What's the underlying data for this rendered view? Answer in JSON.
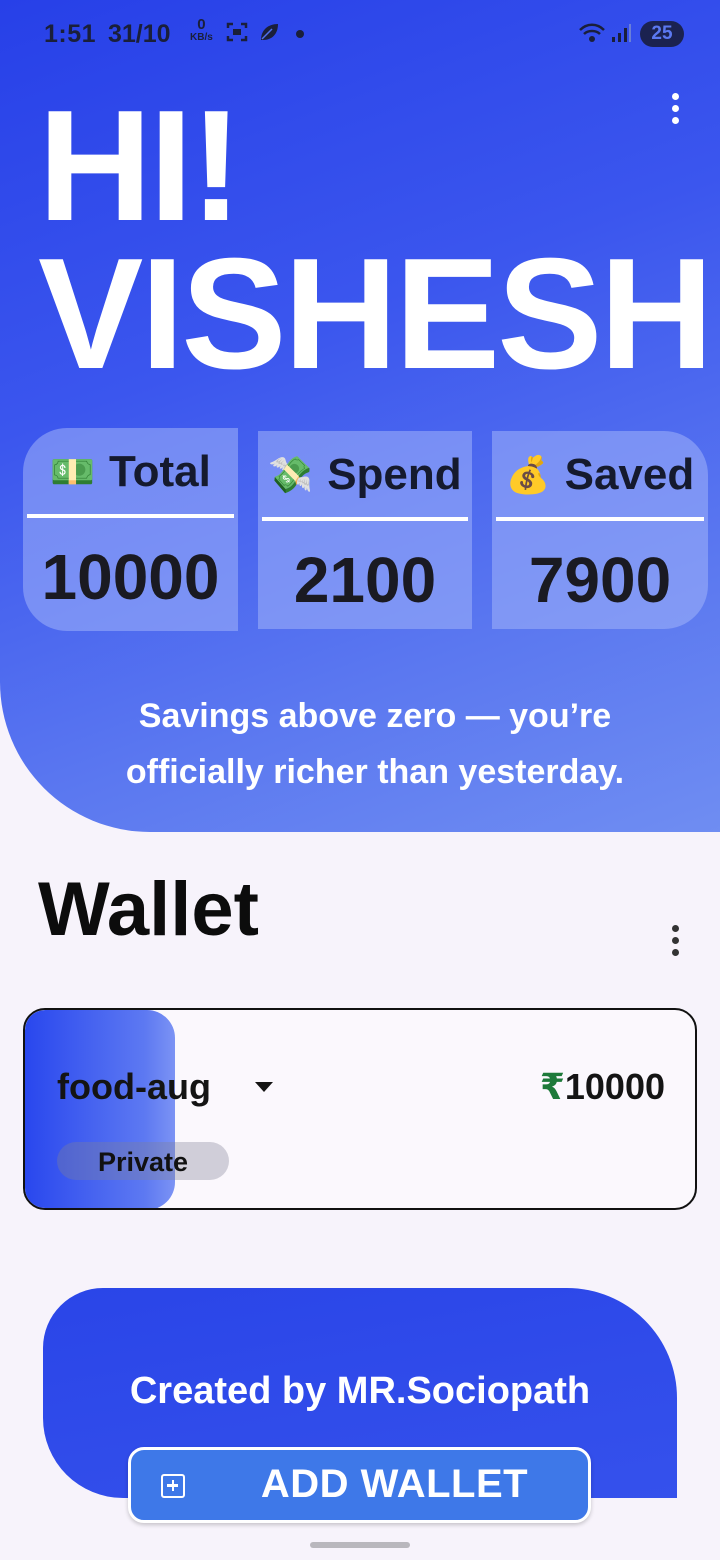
{
  "status_bar": {
    "time": "1:51",
    "date": "31/10",
    "net_speed_value": "0",
    "net_speed_unit": "KB/s",
    "battery": "25",
    "icons": [
      "screenshot-icon",
      "leaf-icon",
      "dot-icon",
      "wifi-icon",
      "signal-icon",
      "battery-icon"
    ]
  },
  "header": {
    "greeting_line1": "HI!",
    "greeting_line2": "VISHESH",
    "menu_icon": "kebab-menu-icon"
  },
  "stats": [
    {
      "emoji": "💵",
      "label": "Total",
      "value": "10000"
    },
    {
      "emoji": "💸",
      "label": "Spend",
      "value": "2100"
    },
    {
      "emoji": "💰",
      "label": "Saved",
      "value": "7900"
    }
  ],
  "quote": "Savings above zero — you’re officially richer than yesterday.",
  "wallet_section": {
    "title": "Wallet",
    "menu_icon": "kebab-menu-icon",
    "wallets": [
      {
        "name": "food-aug",
        "currency": "₹",
        "amount": "10000",
        "visibility": "Private"
      }
    ]
  },
  "footer": {
    "credit": "Created by MR.Sociopath",
    "add_wallet_label": "ADD WALLET",
    "add_icon": "add-box-icon"
  },
  "colors": {
    "hero_gradient_start": "#2740e8",
    "hero_gradient_end": "#6f8df2",
    "amount_currency": "#1e7a3a",
    "button": "#3e78e8",
    "background": "#f7f3fb"
  }
}
